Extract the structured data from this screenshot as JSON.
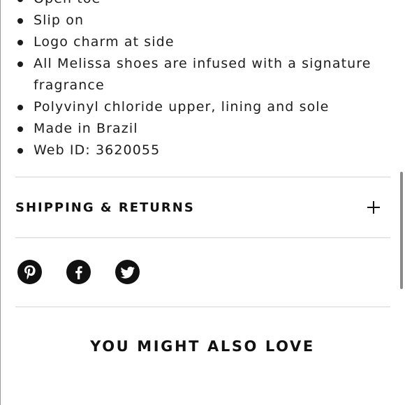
{
  "details": {
    "items": [
      "Open toe",
      "Slip on",
      "Logo charm at side",
      "All Melissa shoes are infused with a signature fragrance",
      "Polyvinyl chloride upper, lining and sole",
      "Made in Brazil",
      "Web ID: 3620055"
    ]
  },
  "shipping": {
    "title": "SHIPPING & RETURNS",
    "toggle_icon": "plus-icon"
  },
  "social": {
    "icons": [
      "pinterest-icon",
      "facebook-icon",
      "twitter-icon"
    ]
  },
  "recommendations": {
    "title": "YOU MIGHT ALSO LOVE"
  }
}
